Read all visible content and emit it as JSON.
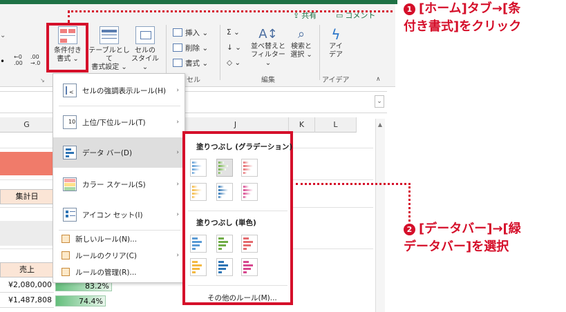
{
  "ribbon": {
    "share_label": "共有",
    "comment_label": "コメント",
    "conditional_format": {
      "line1": "条件付き",
      "line2": "書式 ⌄"
    },
    "format_as_table": {
      "line1": "テーブルとして",
      "line2": "書式設定 ⌄"
    },
    "cell_styles": {
      "line1": "セルの",
      "line2": "スタイル ⌄"
    },
    "insert_label": "挿入 ⌄",
    "delete_label": "削除 ⌄",
    "format_label": "書式 ⌄",
    "cells_group": "セル",
    "sum_label": "Σ ⌄",
    "fill_label": "↓ ⌄",
    "clear_label": "◇ ⌄",
    "sort_filter": {
      "line1": "並べ替えと",
      "line2": "フィルター ⌄"
    },
    "find_select": {
      "line1": "検索と",
      "line2": "選択 ⌄"
    },
    "edit_group": "編集",
    "ideas": {
      "line1": "アイ",
      "line2": "デア"
    },
    "ideas_group": "アイデア",
    "left_num1": "←0",
    "left_num2": ".00",
    "left_num3": ".00",
    "left_num4": "→.0"
  },
  "grid": {
    "columns": [
      "G",
      "J",
      "K",
      "L"
    ],
    "aggregation_date_header": "集計日",
    "sales_header": "売上",
    "rows": [
      {
        "value": "¥2,080,000",
        "bar_label": "83.2%",
        "bar_fraction": 0.832
      },
      {
        "value": "¥1,487,808",
        "bar_label": "74.4%",
        "bar_fraction": 0.744
      }
    ]
  },
  "menu": {
    "items": [
      {
        "label": "セルの強調表示ルール(H)",
        "icon": "highlight-rules-icon"
      },
      {
        "label": "上位/下位ルール(T)",
        "icon": "top-bottom-rules-icon"
      },
      {
        "label": "データ バー(D)",
        "icon": "data-bars-icon"
      },
      {
        "label": "カラー スケール(S)",
        "icon": "color-scales-icon"
      },
      {
        "label": "アイコン セット(I)",
        "icon": "icon-sets-icon"
      }
    ],
    "small_items": [
      {
        "label": "新しいルール(N)..."
      },
      {
        "label": "ルールのクリア(C)"
      },
      {
        "label": "ルールの管理(R)..."
      }
    ]
  },
  "submenu": {
    "gradient_header": "塗りつぶし (グラデーション)",
    "solid_header": "塗りつぶし (単色)",
    "more_rules": "その他のルール(M)...",
    "colors": [
      "#5b9bd5",
      "#70ad47",
      "#e56b6f",
      "#f4b942",
      "#2f75b5",
      "#d8488f"
    ]
  },
  "callouts": {
    "step1_num": "1",
    "step1_line1": "[ホーム]タブ→[条",
    "step1_line2": "付き書式]をクリック",
    "step2_num": "2",
    "step2_line1": "[データバー]→[緑",
    "step2_line2": "データバー]を選択"
  }
}
